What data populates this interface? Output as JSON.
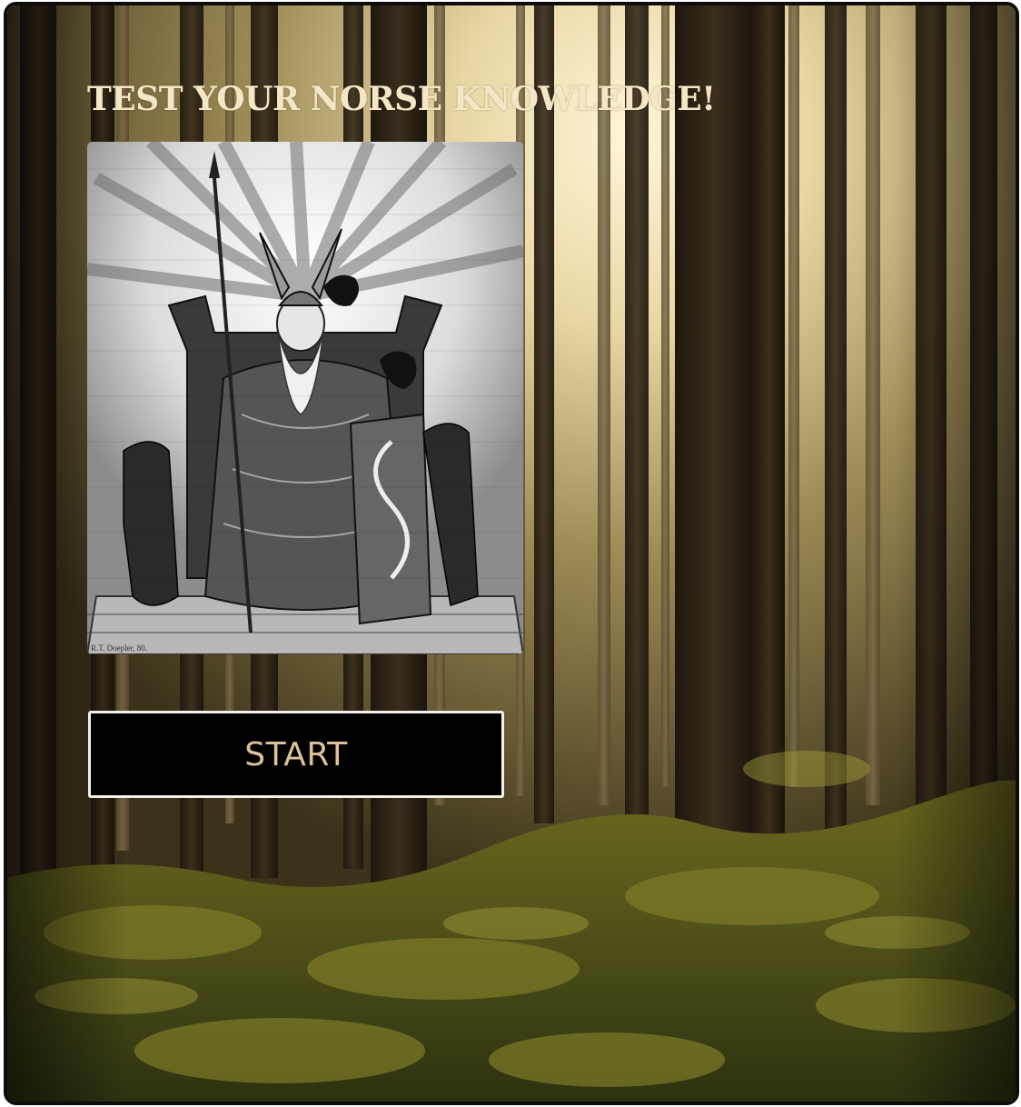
{
  "page": {
    "title": "TEST YOUR NORSE KNOWLEDGE!",
    "image": {
      "subject": "odin-on-throne-engraving",
      "signature": "R.T. Doepler, 80."
    },
    "start_label": "START"
  },
  "colors": {
    "title": "#f3e7c7",
    "button_bg": "#000000",
    "button_text": "#dcc29a",
    "button_border": "#f3f0e8",
    "frame": "#0d0d0d"
  },
  "icons": {
    "background": "forest-background",
    "portrait": "odin-portrait"
  }
}
